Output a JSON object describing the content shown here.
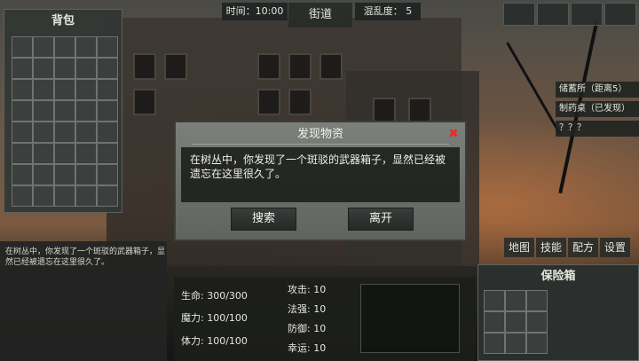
{
  "topbar": {
    "time": "时间：10:00",
    "location": "街道",
    "chaos": "混乱度： 5"
  },
  "backpack": {
    "title": "背包"
  },
  "log": {
    "text": "在树丛中，你发现了一个斑驳的武器箱子，显然已经被遗忘在这里很久了。"
  },
  "locations": [
    {
      "label": "储蓄所（距离5）"
    },
    {
      "label": "制药桌（已发现）"
    },
    {
      "label": "？？？"
    }
  ],
  "dialog": {
    "title": "发现物资",
    "message": "在树丛中，你发现了一个斑驳的武器箱子，显然已经被遗忘在这里很久了。",
    "close_icon": "close-icon",
    "search_label": "搜索",
    "leave_label": "离开"
  },
  "menu": {
    "map": "地图",
    "skills": "技能",
    "recipes": "配方",
    "settings": "设置"
  },
  "safebox": {
    "title": "保险箱"
  },
  "stats": {
    "hp": "生命: 300/300",
    "mp": "魔力: 100/100",
    "stamina": "体力: 100/100",
    "attack": "攻击: 10",
    "magic": "法强: 10",
    "defense": "防御: 10",
    "luck": "幸运: 10"
  },
  "colors": {
    "close_red": "#e0302a",
    "dialog_bg": "#70746f",
    "panel_bg": "#323634"
  }
}
